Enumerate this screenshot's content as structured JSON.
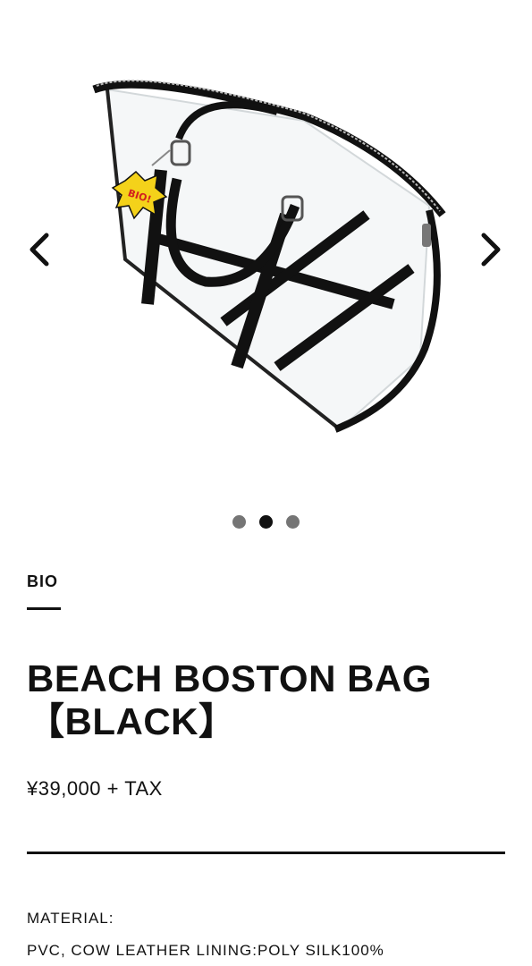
{
  "gallery": {
    "image_alt": "Beach Boston Bag black",
    "prev_icon": "chevron-left-icon",
    "next_icon": "chevron-right-icon",
    "slide_count": 3,
    "active_slide": 2,
    "badge_text": "BIO!"
  },
  "product": {
    "brand": "BIO",
    "title": "BEACH BOSTON BAG【BLACK】",
    "price": "¥39,000 + TAX"
  },
  "details": {
    "material_label": "MATERIAL:",
    "material_value": "PVC, COW LEATHER LINING:POLY SILK100%"
  },
  "colors": {
    "text": "#111111",
    "dot_inactive": "#757575",
    "background": "#ffffff"
  }
}
